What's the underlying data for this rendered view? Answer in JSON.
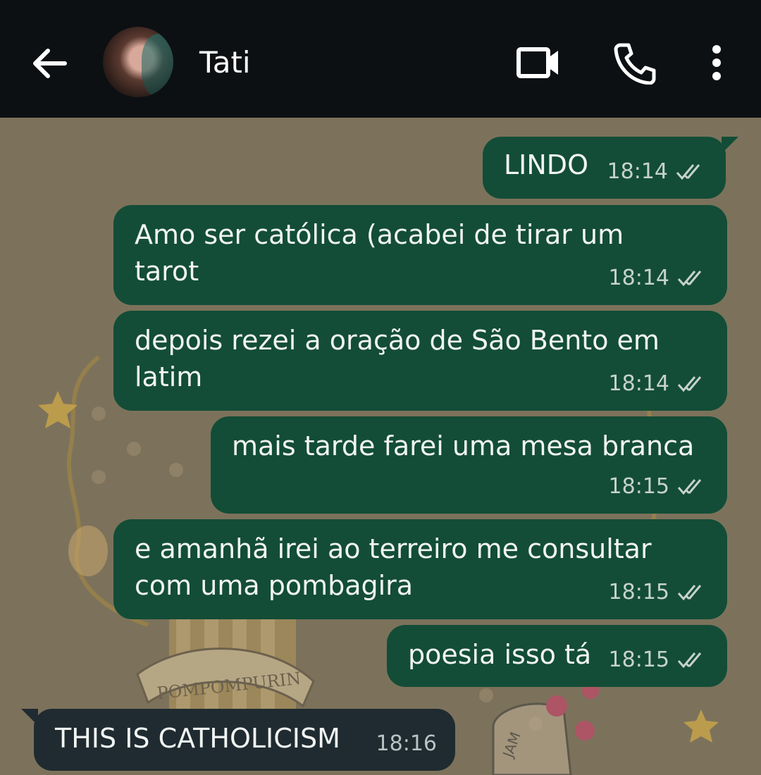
{
  "header": {
    "contact_name": "Tati"
  },
  "messages": [
    {
      "text": "LINDO",
      "time": "18:14",
      "direction": "outgoing"
    },
    {
      "text": "Amo ser católica (acabei de tirar um\ntarot",
      "time": "18:14",
      "direction": "outgoing"
    },
    {
      "text": "depois rezei a oração de São Bento em\nlatim",
      "time": "18:14",
      "direction": "outgoing"
    },
    {
      "text": "mais tarde farei uma mesa branca",
      "time": "18:15",
      "direction": "outgoing"
    },
    {
      "text": "e amanhã irei ao terreiro me consultar\ncom uma pombagira",
      "time": "18:15",
      "direction": "outgoing"
    },
    {
      "text": "poesia isso tá",
      "time": "18:15",
      "direction": "outgoing"
    },
    {
      "text": "THIS IS CATHOLICISM",
      "time": "18:16",
      "direction": "incoming"
    }
  ],
  "wallpaper": {
    "banner_text": "POMPOMPURIN",
    "jar_text": "JAM"
  },
  "colors": {
    "topbar": "#0c1013",
    "outgoing_bubble": "#134d37",
    "incoming_bubble": "#1f2b31",
    "wallpaper": "#7c725b"
  },
  "icons": [
    "back-arrow-icon",
    "video-call-icon",
    "phone-icon",
    "more-vert-icon",
    "double-check-icon"
  ]
}
